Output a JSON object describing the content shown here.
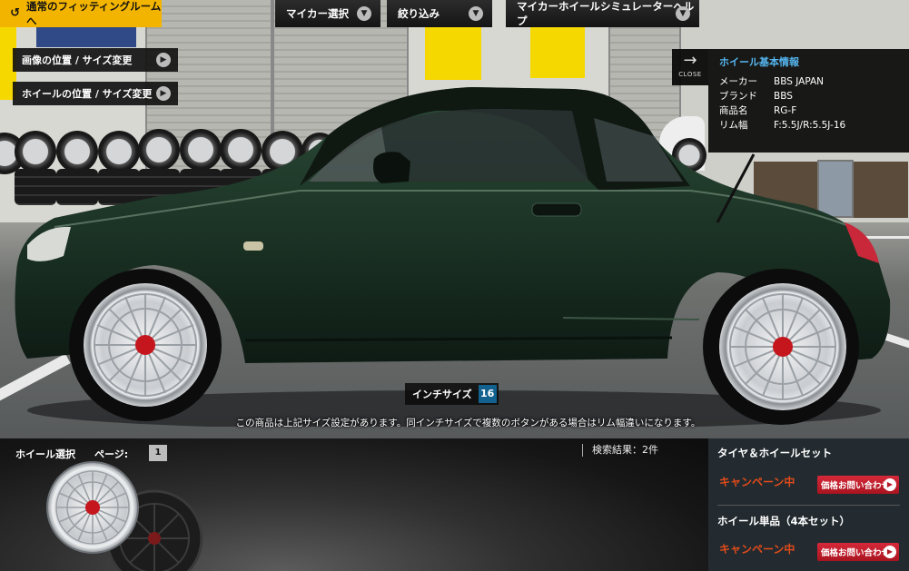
{
  "top_buttons": {
    "fitting_room": "通常のフィッティングルームへ",
    "my_car_select": "マイカー選択",
    "filter": "絞り込み",
    "help": "マイカーホイールシミュレーターヘルプ"
  },
  "side_buttons": {
    "image_position": "画像の位置 / サイズ変更",
    "wheel_position": "ホイールの位置 / サイズ変更"
  },
  "close_label": "CLOSE",
  "wheel_info": {
    "title": "ホイール基本情報",
    "rows": [
      {
        "key": "メーカー",
        "value": "BBS JAPAN"
      },
      {
        "key": "ブランド",
        "value": "BBS"
      },
      {
        "key": "商品名",
        "value": "RG-F"
      },
      {
        "key": "リム幅",
        "value": "F:5.5J/R:5.5J-16"
      }
    ]
  },
  "inch": {
    "label": "インチサイズ",
    "value": "16"
  },
  "notice": "この商品は上記サイズ設定があります。同インチサイズで複数のボタンがある場合はリム幅違いになります。",
  "wheel_select": {
    "label": "ホイール選択",
    "page_label": "ページ:",
    "page": "1",
    "results": "検索結果：2件"
  },
  "right_panel": {
    "set_title": "タイヤ＆ホイールセット",
    "set_campaign": "キャンペーン中",
    "set_button": "価格お問い合わせ",
    "single_title": "ホイール単品（4本セット）",
    "single_campaign": "キャンペーン中",
    "single_button": "価格お問い合わせ"
  },
  "colors": {
    "accent_yellow": "#f3b400",
    "info_title_blue": "#55b6ef",
    "inch_badge": "#12618e",
    "campaign_orange": "#e24b1a",
    "inquiry_red": "#c01e2c",
    "car_body": "#1c3426"
  },
  "icons": {
    "fitting": "u-turn-icon",
    "dropdown": "chevron-down-icon",
    "side": "chevron-right-icon",
    "close": "arrow-right-icon"
  }
}
